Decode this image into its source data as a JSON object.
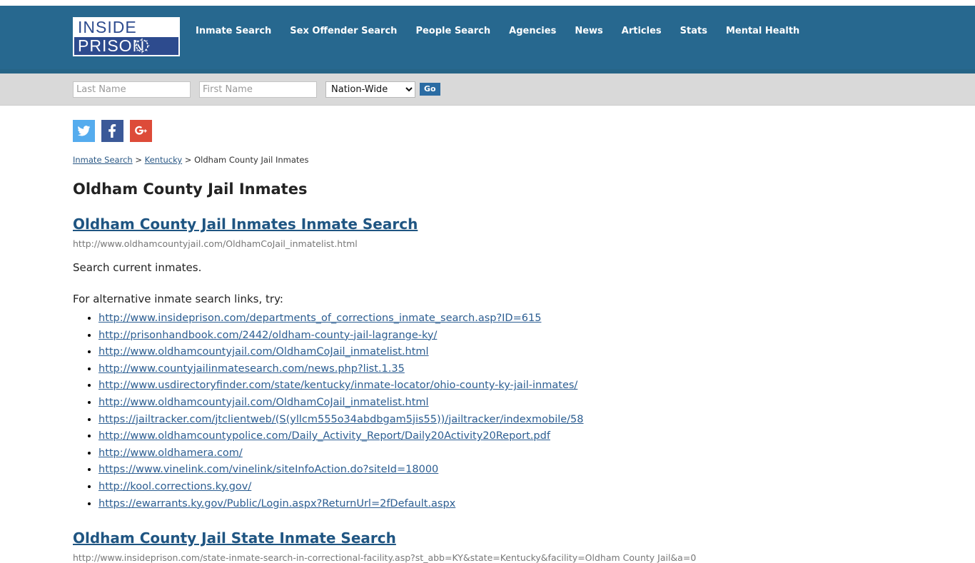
{
  "header": {
    "logo": {
      "line1": "INSIDE",
      "line2": "PRISON",
      "wire_icon": "barbed-wire-circle-icon"
    },
    "nav": [
      {
        "label": "Inmate Search"
      },
      {
        "label": "Sex Offender Search"
      },
      {
        "label": "People Search"
      },
      {
        "label": "Agencies"
      },
      {
        "label": "News"
      },
      {
        "label": "Articles"
      },
      {
        "label": "Stats"
      },
      {
        "label": "Mental Health"
      }
    ],
    "colors": {
      "header_bg": "#27688f",
      "header_border": "#266486",
      "searchbar_bg": "#d9d9d9",
      "go_button_bg": "#2b6ca3",
      "link_blue": "#2b5d91"
    }
  },
  "search": {
    "last_name_placeholder": "Last Name",
    "last_name_value": "",
    "first_name_placeholder": "First Name",
    "first_name_value": "",
    "region_selected": "Nation-Wide",
    "region_options": [
      "Nation-Wide"
    ],
    "go_label": "Go"
  },
  "social": [
    {
      "name": "twitter",
      "label": "Twitter",
      "color": "#55acee"
    },
    {
      "name": "facebook",
      "label": "Facebook",
      "color": "#3b5998"
    },
    {
      "name": "googleplus",
      "label": "Google Plus",
      "color": "#dd4b39"
    }
  ],
  "breadcrumb": {
    "item1": "Inmate Search",
    "sep1": " > ",
    "item2": "Kentucky",
    "sep2": " > ",
    "current": "Oldham County Jail Inmates"
  },
  "page": {
    "title": "Oldham County Jail Inmates"
  },
  "sections": [
    {
      "heading": "Oldham County Jail Inmates Inmate Search",
      "url": "http://www.oldhamcountyjail.com/OldhamCoJail_inmatelist.html",
      "description": "Search current inmates.",
      "alt_intro": "For alternative inmate search links, try:",
      "links": [
        "http://www.insideprison.com/departments_of_corrections_inmate_search.asp?ID=615",
        "http://prisonhandbook.com/2442/oldham-county-jail-lagrange-ky/",
        "http://www.oldhamcountyjail.com/OldhamCoJail_inmatelist.html",
        "http://www.countyjailinmatesearch.com/news.php?list.1.35",
        "http://www.usdirectoryfinder.com/state/kentucky/inmate-locator/ohio-county-ky-jail-inmates/",
        "http://www.oldhamcountyjail.com/OldhamCoJail_inmatelist.html",
        "https://jailtracker.com/jtclientweb/(S(yllcm555o34abdbgam5jis55))/jailtracker/indexmobile/58",
        "http://www.oldhamcountypolice.com/Daily_Activity_Report/Daily20Activity20Report.pdf",
        "http://www.oldhamera.com/",
        "https://www.vinelink.com/vinelink/siteInfoAction.do?siteId=18000",
        "http://kool.corrections.ky.gov/",
        "https://ewarrants.ky.gov/Public/Login.aspx?ReturnUrl=2fDefault.aspx"
      ]
    },
    {
      "heading": "Oldham County Jail State Inmate Search",
      "url": "http://www.insideprison.com/state-inmate-search-in-correctional-facility.asp?st_abb=KY&state=Kentucky&facility=Oldham County Jail&a=0"
    }
  ]
}
